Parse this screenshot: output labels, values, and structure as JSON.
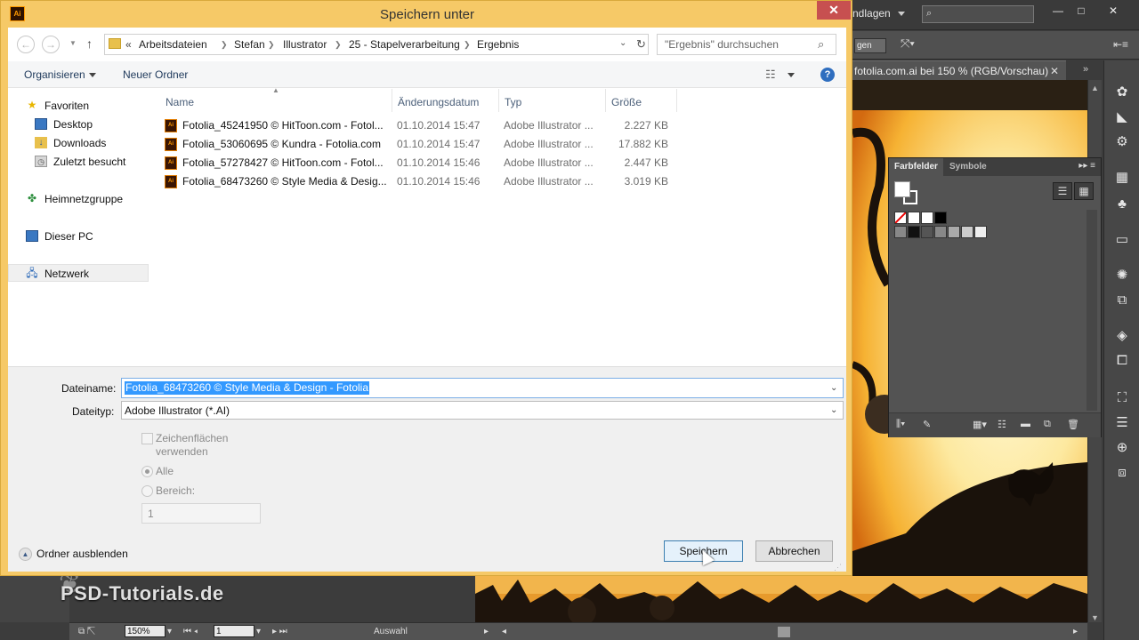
{
  "dialog": {
    "title": "Speichern unter",
    "app_icon": "Ai",
    "close_label": "✕"
  },
  "navbar": {
    "breadcrumb_prefix": "«",
    "breadcrumbs": [
      "Arbeitsdateien",
      "Stefan",
      "Illustrator",
      "25 - Stapelverarbeitung",
      "Ergebnis"
    ],
    "search_placeholder": "\"Ergebnis\" durchsuchen"
  },
  "toolbar": {
    "organize_label": "Organisieren",
    "new_folder_label": "Neuer Ordner",
    "help_label": "?"
  },
  "navpane": {
    "items": [
      {
        "label": "Favoriten",
        "icon": "star-icon"
      },
      {
        "label": "Desktop",
        "icon": "desktop-icon"
      },
      {
        "label": "Downloads",
        "icon": "downloads-icon"
      },
      {
        "label": "Zuletzt besucht",
        "icon": "recent-icon"
      },
      {
        "label": "Heimnetzgruppe",
        "icon": "homegroup-icon"
      },
      {
        "label": "Dieser PC",
        "icon": "pc-icon"
      },
      {
        "label": "Netzwerk",
        "icon": "network-icon"
      }
    ]
  },
  "filelist": {
    "columns": [
      "Name",
      "Änderungsdatum",
      "Typ",
      "Größe"
    ],
    "files": [
      {
        "name": "Fotolia_45241950 © HitToon.com - Fotol...",
        "date": "01.10.2014 15:47",
        "type": "Adobe Illustrator ...",
        "size": "2.227 KB"
      },
      {
        "name": "Fotolia_53060695 © Kundra - Fotolia.com",
        "date": "01.10.2014 15:47",
        "type": "Adobe Illustrator ...",
        "size": "17.882 KB"
      },
      {
        "name": "Fotolia_57278427 © HitToon.com - Fotol...",
        "date": "01.10.2014 15:46",
        "type": "Adobe Illustrator ...",
        "size": "2.447 KB"
      },
      {
        "name": "Fotolia_68473260 © Style Media & Desig...",
        "date": "01.10.2014 15:46",
        "type": "Adobe Illustrator ...",
        "size": "3.019 KB"
      }
    ],
    "file_icon_label": "Ai"
  },
  "form": {
    "filename_label": "Dateiname:",
    "filename_value": "Fotolia_68473260 © Style Media & Design - Fotolia",
    "filetype_label": "Dateityp:",
    "filetype_value": "Adobe Illustrator (*.AI)",
    "artboards_line1": "Zeichenflächen",
    "artboards_line2": "verwenden",
    "radio_all": "Alle",
    "radio_range": "Bereich:",
    "range_value": "1",
    "hide_folders": "Ordner ausblenden",
    "save_label": "Speichern",
    "cancel_label": "Abbrechen"
  },
  "illustrator": {
    "workspace_label": "ndlagen",
    "control_button": "gen",
    "doc_tab": "fotolia.com.ai bei 150 % (RGB/Vorschau)",
    "swatch_tabs": [
      "Farbfelder",
      "Symbole"
    ],
    "watermark": "PSD-Tutorials.de",
    "zoom_value": "150%",
    "page_value": "1",
    "status_text": "Auswahl"
  },
  "colors": {
    "dialog_frame": "#f6c967",
    "close_button": "#c75050",
    "selection": "#3399ff",
    "ai_orange": "#ff9a00"
  }
}
